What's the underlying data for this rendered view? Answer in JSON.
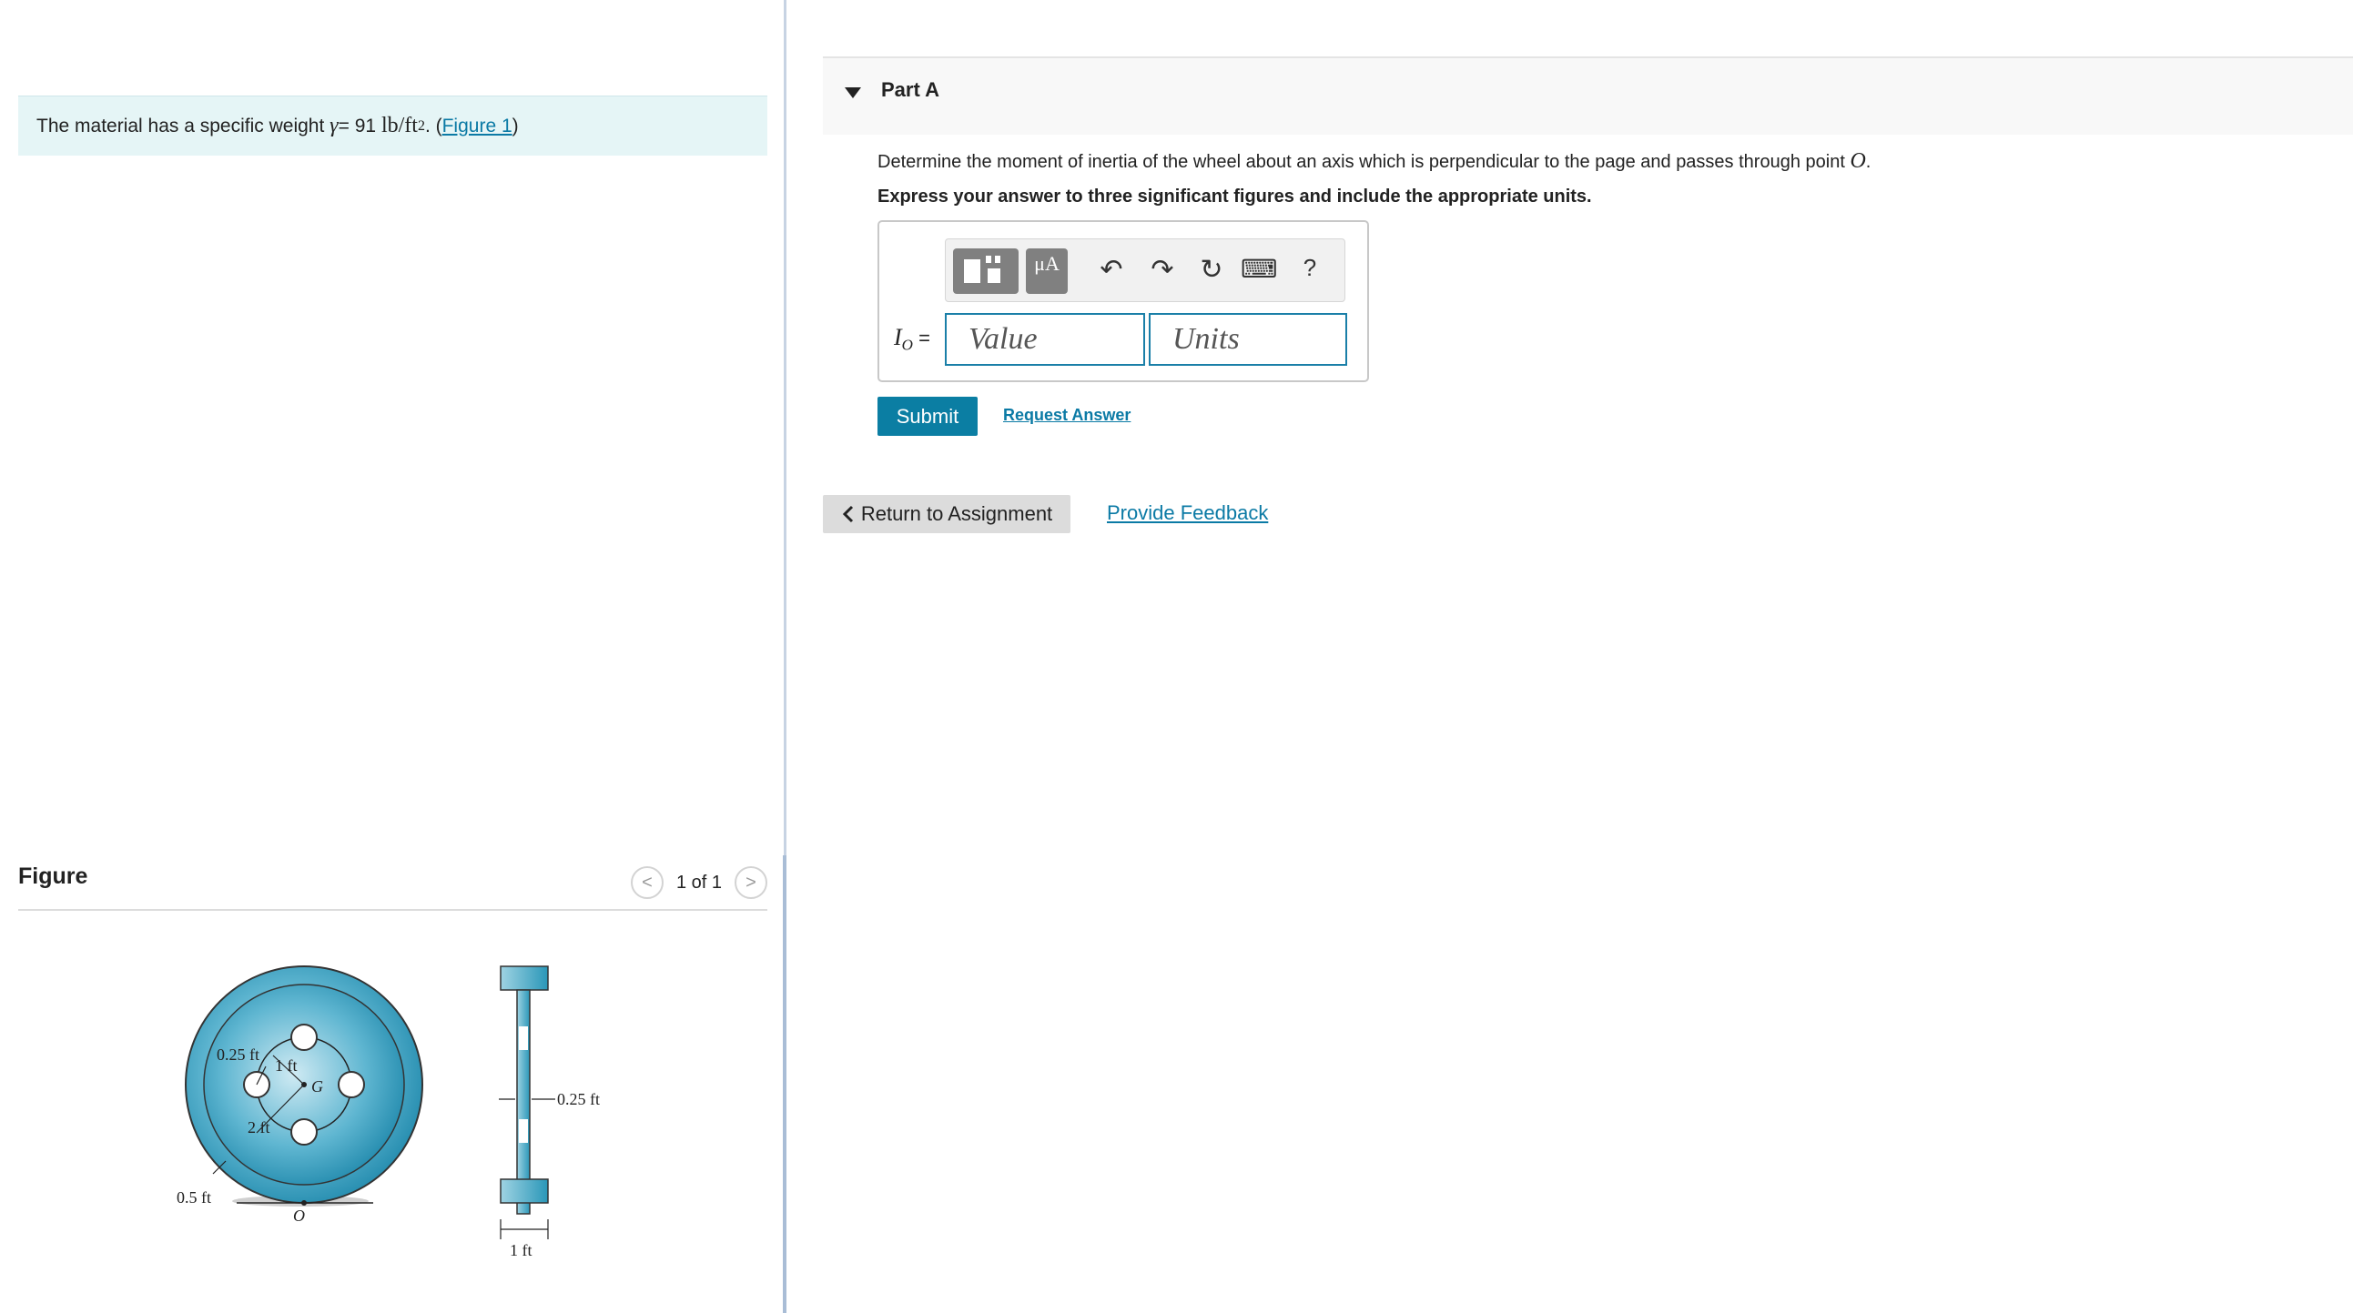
{
  "problem": {
    "prefix": "The material has a specific weight",
    "gamma_symbol": "γ",
    "equals": " = 91",
    "units": "lb/ft",
    "exponent": "2",
    "period": ". (",
    "figure_link": "Figure 1",
    "close_paren": ")"
  },
  "figure": {
    "title": "Figure",
    "pager_text": "1 of 1",
    "prev_glyph": "<",
    "next_glyph": ">",
    "labels": {
      "r_hole": "0.25 ft",
      "r_inner": "1 ft",
      "center": "G",
      "r_outer": "2 ft",
      "rim": "0.5 ft",
      "point": "O",
      "web": "0.25 ft",
      "width": "1 ft"
    }
  },
  "partA": {
    "title": "Part A",
    "question": "Determine the moment of inertia of the wheel about an axis which is perpendicular to the page and passes through point",
    "question_point": "O",
    "question_end": ".",
    "instruction": "Express your answer to three significant figures and include the appropriate units.",
    "toolbar": {
      "templates_icon": "templates-icon",
      "units_label": "μA",
      "undo_glyph": "↶",
      "redo_glyph": "↷",
      "reset_glyph": "↻",
      "keyboard_glyph": "⌨",
      "help_glyph": "?"
    },
    "io_label": "I",
    "io_sub": "O",
    "io_eq": " =",
    "value_placeholder": "Value",
    "units_placeholder": "Units",
    "submit_label": "Submit",
    "request_label": "Request Answer"
  },
  "footer": {
    "return_label": "Return to Assignment",
    "feedback_label": "Provide Feedback"
  },
  "colors": {
    "accent": "#0b7ea3",
    "wheel": "#2a97b8",
    "problem_bg": "#e5f5f6"
  }
}
